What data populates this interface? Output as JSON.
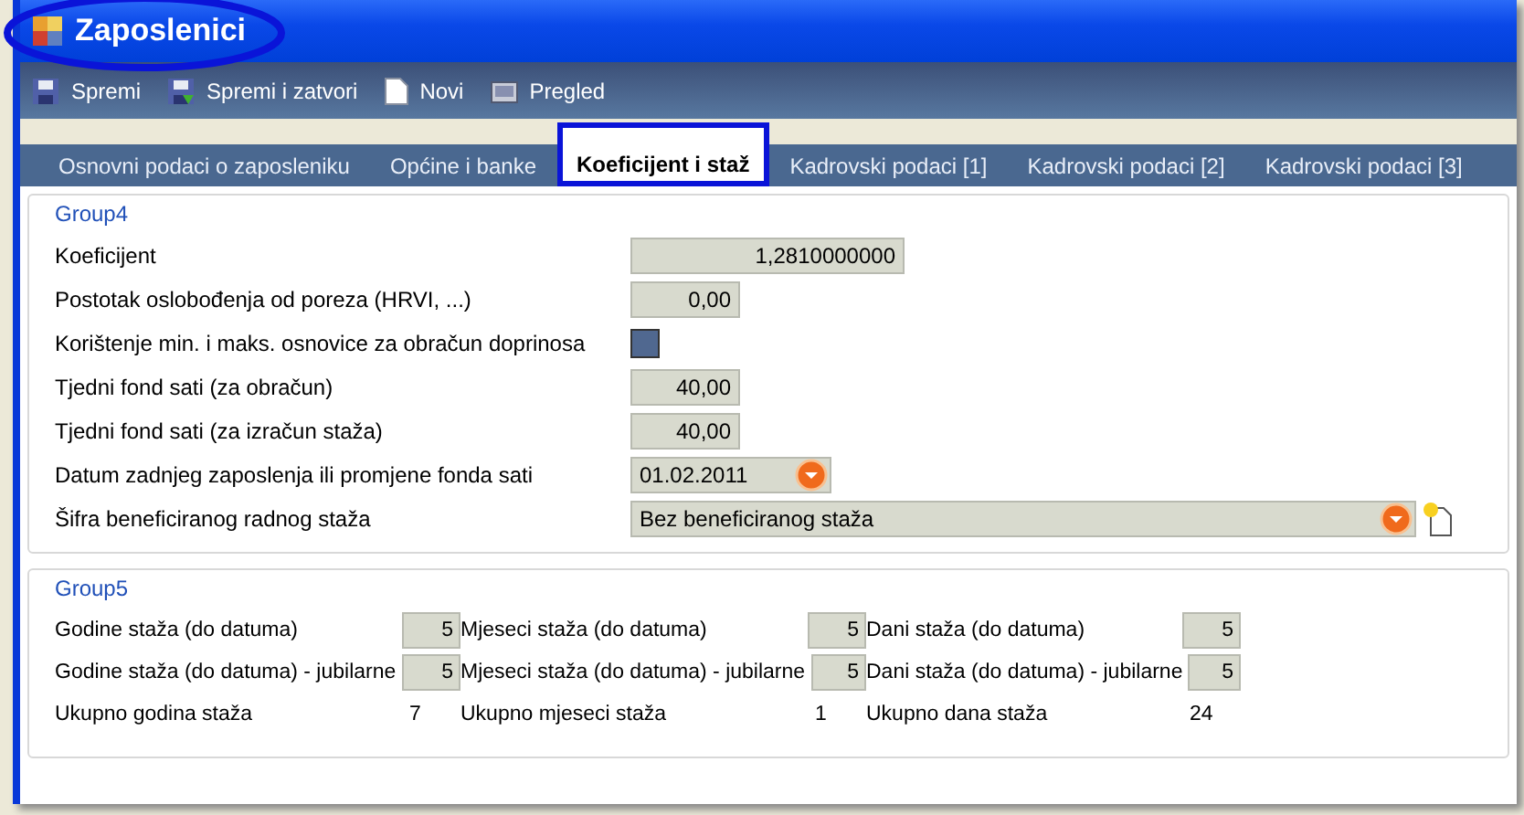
{
  "window": {
    "title": "Zaposlenici"
  },
  "toolbar": [
    {
      "label": "Spremi",
      "kind": "save"
    },
    {
      "label": "Spremi i zatvori",
      "kind": "save-close"
    },
    {
      "label": "Novi",
      "kind": "new"
    },
    {
      "label": "Pregled",
      "kind": "preview"
    }
  ],
  "tabs": [
    {
      "label": "Osnovni podaci o zaposleniku",
      "selected": false
    },
    {
      "label": "Općine i banke",
      "selected": false
    },
    {
      "label": "Koeficijent i staž",
      "selected": true
    },
    {
      "label": "Kadrovski podaci [1]",
      "selected": false
    },
    {
      "label": "Kadrovski podaci [2]",
      "selected": false
    },
    {
      "label": "Kadrovski podaci [3]",
      "selected": false
    }
  ],
  "group4": {
    "title": "Group4",
    "fields": [
      {
        "label": "Koeficijent",
        "kind": "wide-number",
        "value": "1,2810000000"
      },
      {
        "label": "Postotak oslobođenja od poreza (HRVI, ...)",
        "kind": "number",
        "value": "0,00"
      },
      {
        "label": "Korištenje min. i maks. osnovice za obračun doprinosa",
        "kind": "checkbox",
        "checked": false
      },
      {
        "label": "Tjedni fond sati (za obračun)",
        "kind": "number",
        "value": "40,00"
      },
      {
        "label": "Tjedni fond sati (za izračun staža)",
        "kind": "number",
        "value": "40,00"
      },
      {
        "label": "Datum zadnjeg zaposlenja ili promjene fonda sati",
        "kind": "date",
        "value": "01.02.2011"
      },
      {
        "label": "Šifra beneficiranog radnog staža",
        "kind": "dropdown",
        "value": "Bez beneficiranog staža"
      }
    ]
  },
  "group5": {
    "title": "Group5",
    "columns": [
      [
        {
          "label": "Godine staža (do datuma)",
          "kind": "field",
          "value": "5"
        },
        {
          "label": "Godine staža (do datuma)  - jubilarne",
          "kind": "field",
          "value": "5"
        },
        {
          "label": "Ukupno godina staža",
          "kind": "total",
          "value": "7"
        }
      ],
      [
        {
          "label": "Mjeseci staža (do datuma)",
          "kind": "field",
          "value": "5"
        },
        {
          "label": "Mjeseci staža (do datuma) - jubilarne",
          "kind": "field",
          "value": "5"
        },
        {
          "label": "Ukupno mjeseci staža",
          "kind": "total",
          "value": "1"
        }
      ],
      [
        {
          "label": "Dani staža (do datuma)",
          "kind": "field",
          "value": "5"
        },
        {
          "label": "Dani staža (do datuma) - jubilarne",
          "kind": "field",
          "value": "5"
        },
        {
          "label": "Ukupno dana staža",
          "kind": "total",
          "value": "24"
        }
      ]
    ]
  }
}
